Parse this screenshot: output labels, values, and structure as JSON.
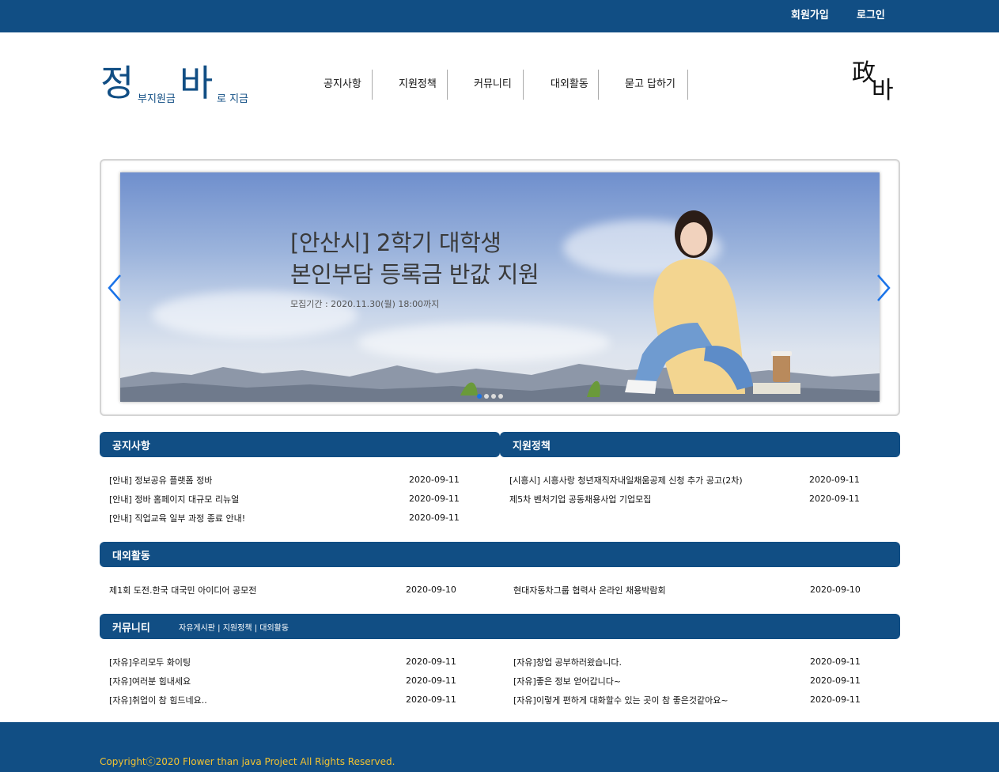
{
  "auth": {
    "signup": "회원가입",
    "login": "로그인"
  },
  "logo": {
    "char1": "정",
    "text1": "부지원금",
    "char2": "바",
    "text2": "로 지금"
  },
  "nav": [
    "공지사항",
    "지원정책",
    "커뮤니티",
    "대외활동",
    "묻고 답하기"
  ],
  "mark": {
    "c1": "政",
    "c2": "바"
  },
  "slide": {
    "line1": "[안산시] 2학기 대학생",
    "line2": "본인부담 등록금 반값 지원",
    "period": "모집기간 : 2020.11.30(월) 18:00까지",
    "active_index": 0,
    "count": 4
  },
  "notice": {
    "title": "공지사항",
    "items": [
      {
        "title": "[안내] 정보공유 플랫폼 정바",
        "date": "2020-09-11"
      },
      {
        "title": "[안내] 정바 홈페이지 대규모 리뉴얼",
        "date": "2020-09-11"
      },
      {
        "title": "[안내] 직업교육 일부 과정 종료 안내!",
        "date": "2020-09-11"
      }
    ]
  },
  "policy": {
    "title": "지원정책",
    "items": [
      {
        "title": "[시흥시] 시흥사랑 청년재직자내일채움공제 신청 추가 공고(2차)",
        "date": "2020-09-11"
      },
      {
        "title": "제5차 벤처기업 공동채용사업 기업모집",
        "date": "2020-09-11"
      }
    ]
  },
  "activity": {
    "title": "대외활동",
    "items": [
      {
        "title": "제1회 도전.한국 대국민 아이디어 공모전",
        "date": "2020-09-10"
      },
      {
        "title": "현대자동차그룹 협력사 온라인 채용박람회",
        "date": "2020-09-10"
      }
    ]
  },
  "community": {
    "title": "커뮤니티",
    "links": [
      "자유게시판",
      "지원정책",
      "대외활동"
    ],
    "sep": " | ",
    "left": [
      {
        "title": "[자유]우리모두 화이팅",
        "date": "2020-09-11"
      },
      {
        "title": "[자유]여러분 힘내세요",
        "date": "2020-09-11"
      },
      {
        "title": "[자유]취업이 참 힘드네요..",
        "date": "2020-09-11"
      }
    ],
    "right": [
      {
        "title": "[자유]창업 공부하러왔습니다.",
        "date": "2020-09-11"
      },
      {
        "title": "[자유]좋은 정보 얻어갑니다~",
        "date": "2020-09-11"
      },
      {
        "title": "[자유]이렇게 편하게 대화할수 있는 곳이 참 좋은것같아요~",
        "date": "2020-09-11"
      }
    ]
  },
  "footer": {
    "copyright": "Copyrightⓒ2020 Flower than java Project All Rights Reserved."
  },
  "colors": {
    "primary": "#114e84",
    "footer_text": "#f1c232",
    "arrow": "#1a73e8"
  }
}
